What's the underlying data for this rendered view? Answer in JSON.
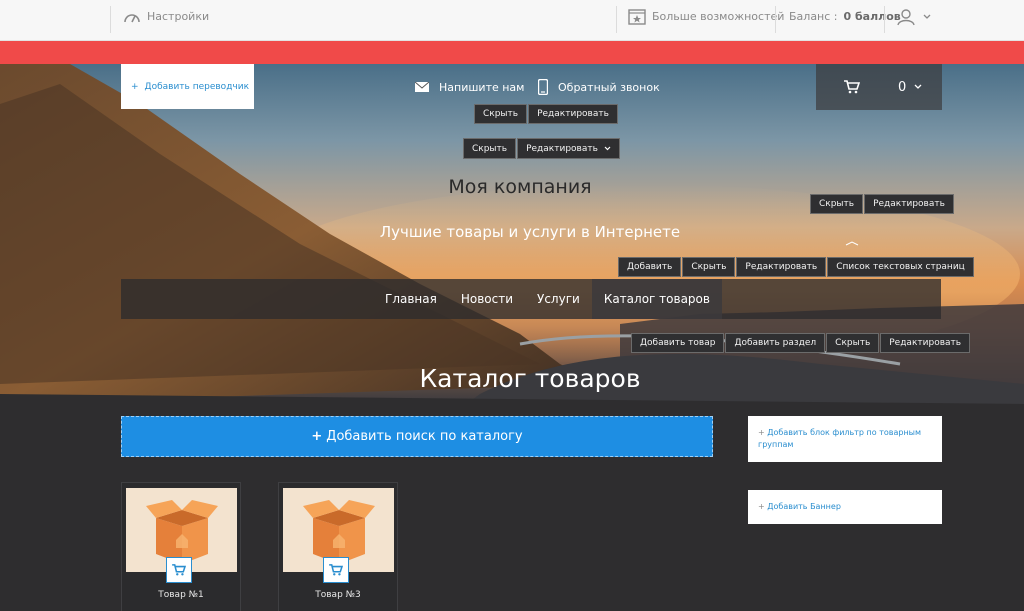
{
  "topbar": {
    "settings": "Настройки",
    "more": "Больше возможностей",
    "balance_label": "Баланс :",
    "balance_value": "0 баллов"
  },
  "header": {
    "add_guide": "Добавить переводчик",
    "write_us": "Напишите нам",
    "callback": "Обратный звонок",
    "cart_count": "0"
  },
  "edit_controls": {
    "hide": "Скрыть",
    "edit": "Редактировать",
    "add": "Добавить",
    "text_pages": "Список текстовых страниц",
    "add_product": "Добавить товар",
    "add_section": "Добавить раздел"
  },
  "company": {
    "name": "Моя компания",
    "slogan": "Лучшие товары и услуги в Интернете"
  },
  "nav": {
    "items": [
      "Главная",
      "Новости",
      "Услуги",
      "Каталог товаров"
    ]
  },
  "catalog": {
    "title": "Каталог товаров",
    "add_search": "Добавить поиск по каталогу",
    "add_filter": "Добавить блок фильтр по товарным группам",
    "add_banner": "Добавить Баннер",
    "products": [
      {
        "name": "Товар №1"
      },
      {
        "name": "Товар №3"
      }
    ]
  },
  "colors": {
    "accent_red": "#f04a49",
    "accent_blue": "#1e8ee3",
    "link_blue": "#2a8ecf"
  }
}
